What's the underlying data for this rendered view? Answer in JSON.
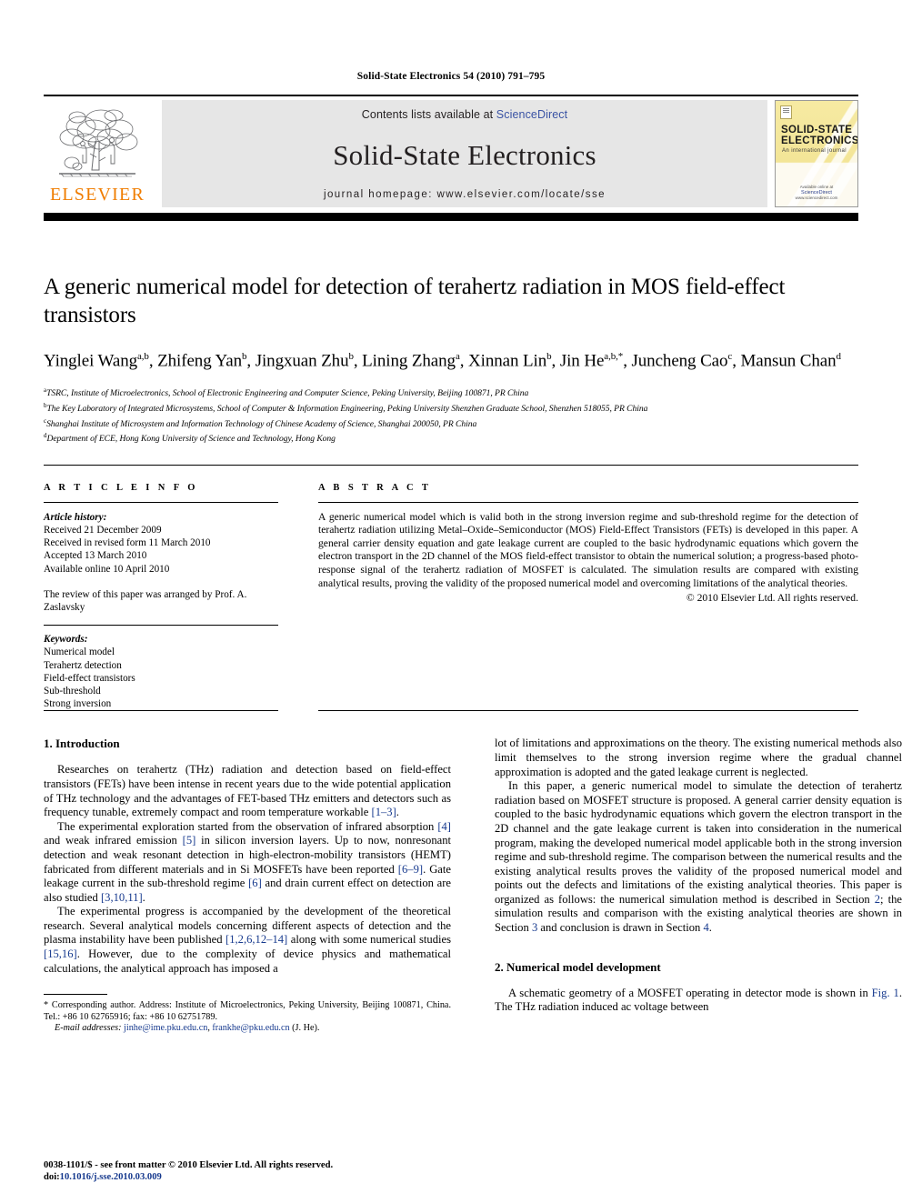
{
  "running_head": "Solid-State Electronics 54 (2010) 791–795",
  "masthead": {
    "publisher_name": "ELSEVIER",
    "contents_prefix": "Contents lists available at ",
    "contents_link": "ScienceDirect",
    "journal_title": "Solid-State Electronics",
    "homepage_line": "journal homepage: www.elsevier.com/locate/sse",
    "cover": {
      "title_line1": "SOLID-STATE",
      "title_line2": "ELECTRONICS",
      "subtitle": "An international journal",
      "foot_label": "Available online at",
      "foot_brand": "ScienceDirect",
      "foot_url": "www.sciencedirect.com"
    },
    "link_color": "#3a53a4",
    "brand_color": "#f07d00",
    "band_color": "#e6e6e6",
    "cover_color": "#f3e7a4"
  },
  "article": {
    "title": "A generic numerical model for detection of terahertz radiation in MOS field-effect transistors",
    "authors_html": "Yinglei Wang a,b, Zhifeng Yan b, Jingxuan Zhu b, Lining Zhang a, Xinnan Lin b, Jin He a,b,*, Juncheng Cao c, Mansun Chan d",
    "affiliations": [
      {
        "marker": "a",
        "text": "TSRC, Institute of Microelectronics, School of Electronic Engineering and Computer Science, Peking University, Beijing 100871, PR China"
      },
      {
        "marker": "b",
        "text": "The Key Laboratory of Integrated Microsystems, School of Computer & Information Engineering, Peking University Shenzhen Graduate School, Shenzhen 518055, PR China"
      },
      {
        "marker": "c",
        "text": "Shanghai Institute of Microsystem and Information Technology of Chinese Academy of Science, Shanghai 200050, PR China"
      },
      {
        "marker": "d",
        "text": "Department of ECE, Hong Kong University of Science and Technology, Hong Kong"
      }
    ]
  },
  "article_info": {
    "heading": "A R T I C L E   I N F O",
    "history_label": "Article history:",
    "history": [
      "Received 21 December 2009",
      "Received in revised form 11 March 2010",
      "Accepted 13 March 2010",
      "Available online 10 April 2010"
    ],
    "review_note": "The review of this paper was arranged by Prof. A. Zaslavsky",
    "keywords_label": "Keywords:",
    "keywords": [
      "Numerical model",
      "Terahertz detection",
      "Field-effect transistors",
      "Sub-threshold",
      "Strong inversion"
    ]
  },
  "abstract": {
    "heading": "A B S T R A C T",
    "text": "A generic numerical model which is valid both in the strong inversion regime and sub-threshold regime for the detection of terahertz radiation utilizing Metal–Oxide–Semiconductor (MOS) Field-Effect Transistors (FETs) is developed in this paper. A general carrier density equation and gate leakage current are coupled to the basic hydrodynamic equations which govern the electron transport in the 2D channel of the MOS field-effect transistor to obtain the numerical solution; a progress-based photo-response signal of the terahertz radiation of MOSFET is calculated. The simulation results are compared with existing analytical results, proving the validity of the proposed numerical model and overcoming limitations of the analytical theories.",
    "copyright": "© 2010 Elsevier Ltd. All rights reserved."
  },
  "body": {
    "section1_title": "1. Introduction",
    "section2_title": "2. Numerical model development",
    "p1_a": "Researches on terahertz (THz) radiation and detection based on field-effect transistors (FETs) have been intense in recent years due to the wide potential application of THz technology and the advantages of FET-based THz emitters and detectors such as frequency tunable, extremely compact and room temperature workable ",
    "p1_ref": "[1–3]",
    "p1_b": ".",
    "p2_a": "The experimental exploration started from the observation of infrared absorption ",
    "p2_r1": "[4]",
    "p2_b": " and weak infrared emission ",
    "p2_r2": "[5]",
    "p2_c": " in silicon inversion layers. Up to now, nonresonant detection and weak resonant detection in high-electron-mobility transistors (HEMT) fabricated from different materials and in Si MOSFETs have been reported ",
    "p2_r3": "[6–9]",
    "p2_d": ". Gate leakage current in the sub-threshold regime ",
    "p2_r4": "[6]",
    "p2_e": " and drain current effect on detection are also studied ",
    "p2_r5": "[3,10,11]",
    "p2_f": ".",
    "p3_a": "The experimental progress is accompanied by the development of the theoretical research. Several analytical models concerning different aspects of detection and the plasma instability have been published ",
    "p3_r1": "[1,2,6,12–14]",
    "p3_b": " along with some numerical studies ",
    "p3_r2": "[15,16]",
    "p3_c": ". However, due to the complexity of device physics and mathematical calculations, the analytical approach has imposed a",
    "p4": "lot of limitations and approximations on the theory. The existing numerical methods also limit themselves to the strong inversion regime where the gradual channel approximation is adopted and the gated leakage current is neglected.",
    "p5_a": "In this paper, a generic numerical model to simulate the detection of terahertz radiation based on MOSFET structure is proposed. A general carrier density equation is coupled to the basic hydrodynamic equations which govern the electron transport in the 2D channel and the gate leakage current is taken into consideration in the numerical program, making the developed numerical model applicable both in the strong inversion regime and sub-threshold regime. The comparison between the numerical results and the existing analytical results proves the validity of the proposed numerical model and points out the defects and limitations of the existing analytical theories. This paper is organized as follows: the numerical simulation method is described in Section ",
    "p5_s2": "2",
    "p5_b": "; the simulation results and comparison with the existing analytical theories are shown in Section ",
    "p5_s3": "3",
    "p5_c": " and conclusion is drawn in Section ",
    "p5_s4": "4",
    "p5_d": ".",
    "p6_a": "A schematic geometry of a MOSFET operating in detector mode is shown in ",
    "p6_fig": "Fig. 1",
    "p6_b": ". The THz radiation induced ac voltage between"
  },
  "footnote": {
    "star": "*",
    "corresponding": " Corresponding author. Address: Institute of Microelectronics, Peking University, Beijing 100871, China. Tel.: +86 10 62765916; fax: +86 10 62751789.",
    "email_label": "E-mail addresses:",
    "email1": "jinhe@ime.pku.edu.cn",
    "email2": "frankhe@pku.edu.cn",
    "email_suffix": " (J. He)."
  },
  "imprint": {
    "line1": "0038-1101/$ - see front matter © 2010 Elsevier Ltd. All rights reserved.",
    "doi_label": "doi:",
    "doi_value": "10.1016/j.sse.2010.03.009"
  }
}
